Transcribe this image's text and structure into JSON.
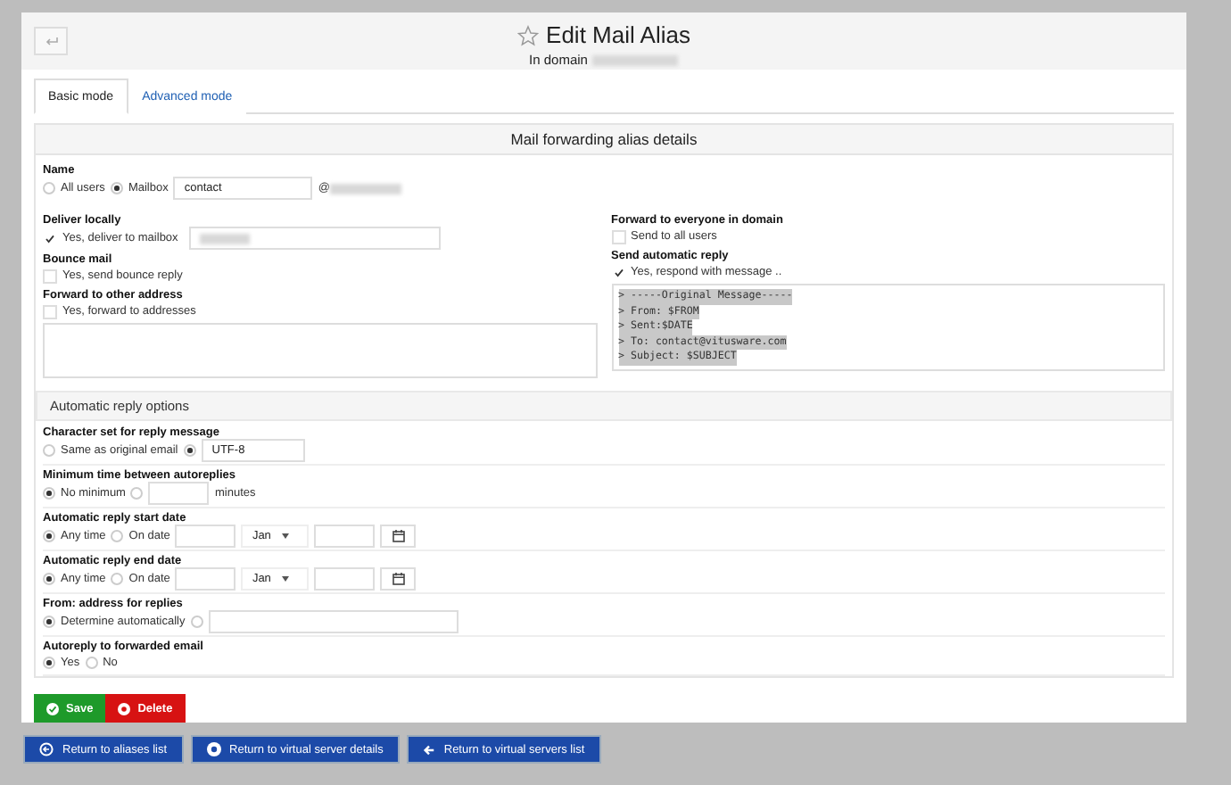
{
  "header": {
    "title": "Edit Mail Alias",
    "subtitle": "In domain"
  },
  "tabs": [
    {
      "label": "Basic mode",
      "selected": true
    },
    {
      "label": "Advanced mode",
      "selected": false
    }
  ],
  "details": {
    "title": "Mail forwarding alias details",
    "name": {
      "label": "Name",
      "options": [
        {
          "label": "All users",
          "selected": false
        },
        {
          "label": "Mailbox",
          "selected": true
        }
      ],
      "mailbox": "contact",
      "at": "@"
    },
    "left": [
      {
        "kind": "check_input",
        "label": "Deliver locally",
        "option": "Yes, deliver to mailbox",
        "checked": true
      },
      {
        "kind": "check",
        "label": "Bounce mail",
        "option": "Yes, send bounce reply",
        "checked": false
      },
      {
        "kind": "check_textarea",
        "label": "Forward to other address",
        "option": "Yes, forward to addresses",
        "checked": false
      }
    ],
    "right": [
      {
        "kind": "check",
        "label": "Forward to everyone in domain",
        "option": "Send to all users",
        "checked": false
      },
      {
        "kind": "check_message",
        "label": "Send automatic reply",
        "option": "Yes, respond with message ..",
        "checked": true,
        "lines": [
          "> -----Original Message-----",
          "> From: $FROM",
          "> Sent:$DATE",
          "> To: contact@vitusware.com",
          "> Subject: $SUBJECT"
        ]
      }
    ]
  },
  "reply": {
    "title": "Automatic reply options",
    "rows": [
      {
        "label": "Character set for reply message",
        "controls": [
          {
            "kind": "radio",
            "label": "Same as original email",
            "selected": false
          },
          {
            "kind": "radio",
            "selected": true
          },
          {
            "kind": "input",
            "value": "UTF-8"
          }
        ]
      },
      {
        "label": "Minimum time between autoreplies",
        "controls": [
          {
            "kind": "radio",
            "label": "No minimum",
            "selected": true
          },
          {
            "kind": "radio",
            "selected": false
          },
          {
            "kind": "input"
          },
          {
            "kind": "suffix",
            "label": "minutes"
          }
        ]
      },
      {
        "label": "Automatic reply start date",
        "controls": [
          {
            "kind": "radio",
            "label": "Any time",
            "selected": true
          },
          {
            "kind": "radio",
            "label": "On date",
            "selected": false
          },
          {
            "kind": "input"
          },
          {
            "kind": "select",
            "value": "Jan"
          },
          {
            "kind": "input"
          },
          {
            "kind": "calendar"
          }
        ]
      },
      {
        "label": "Automatic reply end date",
        "controls": [
          {
            "kind": "radio",
            "label": "Any time",
            "selected": true
          },
          {
            "kind": "radio",
            "label": "On date",
            "selected": false
          },
          {
            "kind": "input"
          },
          {
            "kind": "select",
            "value": "Jan"
          },
          {
            "kind": "input"
          },
          {
            "kind": "calendar"
          }
        ]
      },
      {
        "label": "From: address for replies",
        "controls": [
          {
            "kind": "radio",
            "label": "Determine automatically",
            "selected": true
          },
          {
            "kind": "radio",
            "selected": false
          },
          {
            "kind": "wide_input"
          }
        ]
      },
      {
        "label": "Autoreply to forwarded email",
        "controls": [
          {
            "kind": "radio",
            "label": "Yes",
            "selected": true
          },
          {
            "kind": "radio",
            "label": "No",
            "selected": false
          }
        ]
      }
    ]
  },
  "actions": [
    {
      "kind": "save",
      "label": "Save"
    },
    {
      "kind": "delete",
      "label": "Delete"
    }
  ],
  "footer": [
    {
      "kind": "list",
      "label": "Return to aliases list"
    },
    {
      "kind": "details",
      "label": "Return to virtual server details"
    },
    {
      "kind": "back",
      "label": "Return to virtual servers list"
    }
  ]
}
